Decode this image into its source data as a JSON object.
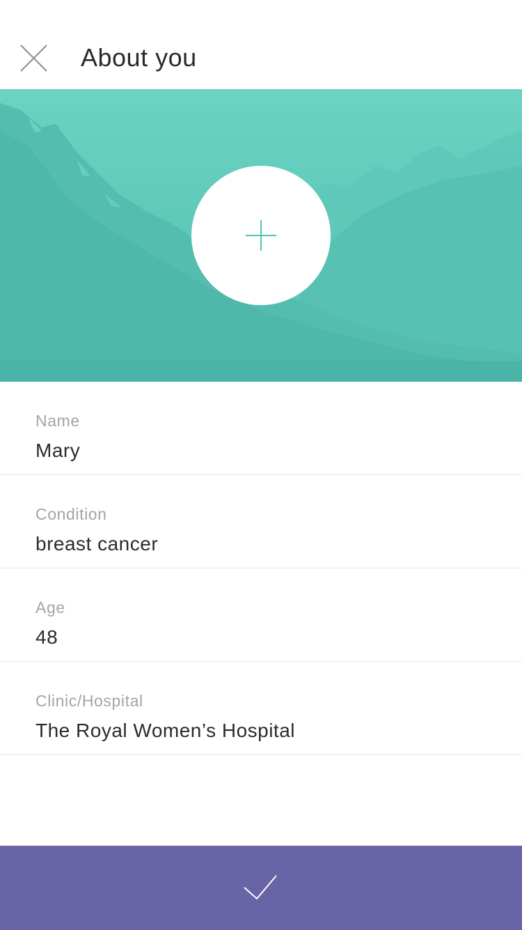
{
  "header": {
    "title": "About you",
    "close_icon": "close-icon"
  },
  "hero": {
    "background": "mountain landscape with teal overlay",
    "add_photo_icon": "plus-icon",
    "accent_color": "#4fc6b5"
  },
  "form": {
    "fields": [
      {
        "label": "Name",
        "value": "Mary"
      },
      {
        "label": "Condition",
        "value": "breast cancer"
      },
      {
        "label": "Age",
        "value": "48"
      },
      {
        "label": "Clinic/Hospital",
        "value": "The Royal Women’s Hospital"
      }
    ]
  },
  "confirm": {
    "icon": "checkmark-icon",
    "color": "#6864a6"
  }
}
